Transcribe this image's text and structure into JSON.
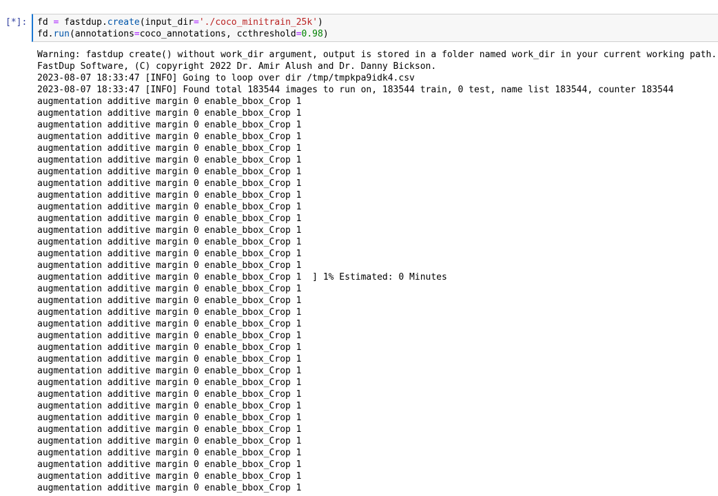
{
  "cell": {
    "prompt": "[*]:",
    "code": {
      "line1": {
        "var": "fd",
        "eq": " = ",
        "obj": "fastdup",
        "dot": ".",
        "method": "create",
        "open": "(",
        "arg": "input_dir",
        "argeq": "=",
        "str": "'./coco_minitrain_25k'",
        "close": ")"
      },
      "line2": {
        "obj": "fd",
        "dot": ".",
        "method": "run",
        "open": "(",
        "arg1": "annotations",
        "eq1": "=",
        "val1": "coco_annotations",
        "comma": ", ",
        "arg2": "ccthreshold",
        "eq2": "=",
        "num": "0.98",
        "close": ")"
      }
    }
  },
  "output": {
    "lines": [
      "Warning: fastdup create() without work_dir argument, output is stored in a folder named work_dir in your current working path.",
      "FastDup Software, (C) copyright 2022 Dr. Amir Alush and Dr. Danny Bickson.",
      "2023-08-07 18:33:47 [INFO] Going to loop over dir /tmp/tmpkpa9idk4.csv",
      "2023-08-07 18:33:47 [INFO] Found total 183544 images to run on, 183544 train, 0 test, name list 183544, counter 183544",
      "augmentation additive margin 0 enable_bbox_Crop 1",
      "augmentation additive margin 0 enable_bbox_Crop 1",
      "augmentation additive margin 0 enable_bbox_Crop 1",
      "augmentation additive margin 0 enable_bbox_Crop 1",
      "augmentation additive margin 0 enable_bbox_Crop 1",
      "augmentation additive margin 0 enable_bbox_Crop 1",
      "augmentation additive margin 0 enable_bbox_Crop 1",
      "augmentation additive margin 0 enable_bbox_Crop 1",
      "augmentation additive margin 0 enable_bbox_Crop 1",
      "augmentation additive margin 0 enable_bbox_Crop 1",
      "augmentation additive margin 0 enable_bbox_Crop 1",
      "augmentation additive margin 0 enable_bbox_Crop 1",
      "augmentation additive margin 0 enable_bbox_Crop 1",
      "augmentation additive margin 0 enable_bbox_Crop 1",
      "augmentation additive margin 0 enable_bbox_Crop 1",
      "augmentation additive margin 0 enable_bbox_Crop 1  ] 1% Estimated: 0 Minutes",
      "augmentation additive margin 0 enable_bbox_Crop 1",
      "augmentation additive margin 0 enable_bbox_Crop 1",
      "augmentation additive margin 0 enable_bbox_Crop 1",
      "augmentation additive margin 0 enable_bbox_Crop 1",
      "augmentation additive margin 0 enable_bbox_Crop 1",
      "augmentation additive margin 0 enable_bbox_Crop 1",
      "augmentation additive margin 0 enable_bbox_Crop 1",
      "augmentation additive margin 0 enable_bbox_Crop 1",
      "augmentation additive margin 0 enable_bbox_Crop 1",
      "augmentation additive margin 0 enable_bbox_Crop 1",
      "augmentation additive margin 0 enable_bbox_Crop 1",
      "augmentation additive margin 0 enable_bbox_Crop 1",
      "augmentation additive margin 0 enable_bbox_Crop 1",
      "augmentation additive margin 0 enable_bbox_Crop 1",
      "augmentation additive margin 0 enable_bbox_Crop 1",
      "augmentation additive margin 0 enable_bbox_Crop 1",
      "augmentation additive margin 0 enable_bbox_Crop 1",
      "augmentation additive margin 0 enable_bbox_Crop 1"
    ]
  },
  "colors": {
    "prompt": "#303f9f",
    "active_border": "#1976d2",
    "input_bg": "#f7f7f7",
    "string": "#ba2121",
    "number": "#008000",
    "operator": "#aa22ff",
    "attribute": "#0055aa"
  }
}
